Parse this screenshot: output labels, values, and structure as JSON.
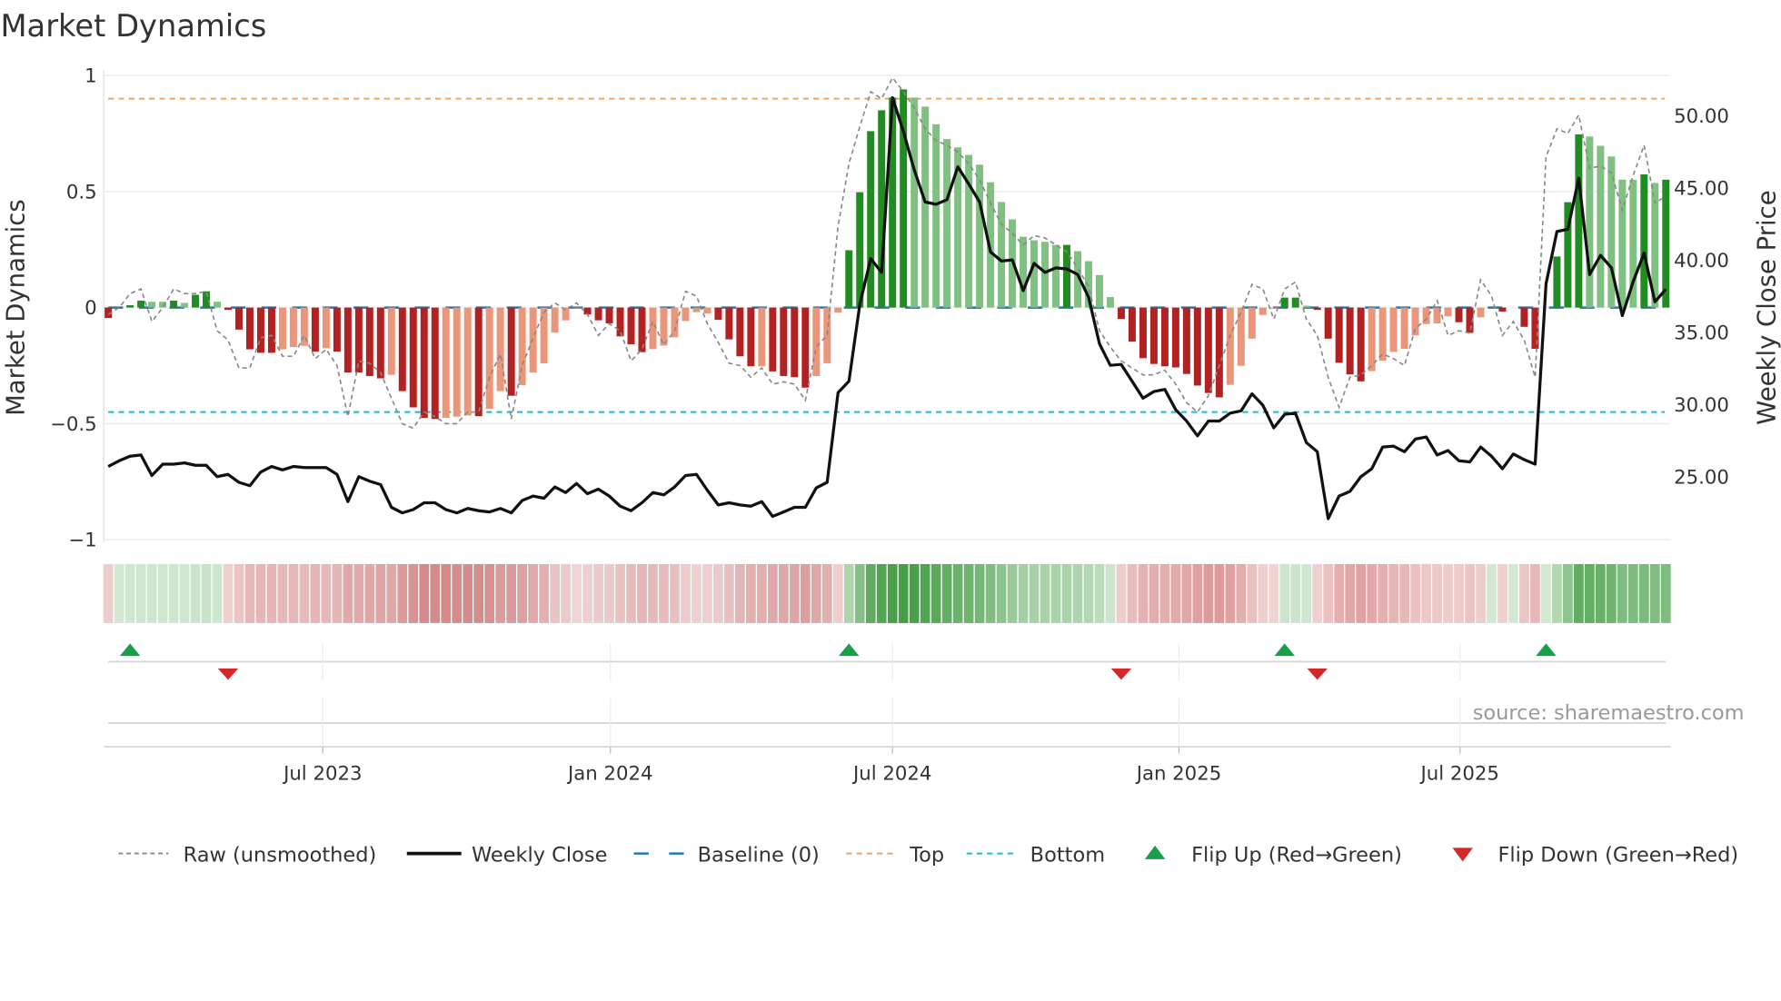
{
  "title": "Market Dynamics",
  "source": "source: sharemaestro.com",
  "chart_data": {
    "type": "bar",
    "title": "Market Dynamics",
    "ylabel": "Market Dynamics",
    "y2label": "Weekly Close Price",
    "ylim": [
      -1,
      1
    ],
    "y2lim": [
      20.44,
      52.67
    ],
    "grid": true,
    "legend_position": "bottom",
    "yticks": [
      {
        "value": 1,
        "label": "1"
      },
      {
        "value": 0.5,
        "label": "0.5"
      },
      {
        "value": 0,
        "label": "0"
      },
      {
        "value": -0.5,
        "label": "−0.5"
      },
      {
        "value": -1,
        "label": "−1"
      }
    ],
    "y2ticks": [
      {
        "value": 50,
        "label": "50.00"
      },
      {
        "value": 45,
        "label": "45.00"
      },
      {
        "value": 40,
        "label": "40.00"
      },
      {
        "value": 35,
        "label": "35.00"
      },
      {
        "value": 30,
        "label": "30.00"
      },
      {
        "value": 25,
        "label": "25.00"
      }
    ],
    "xticks": [
      {
        "week": 19.7,
        "label": "Jul 2023"
      },
      {
        "week": 46.1,
        "label": "Jan 2024"
      },
      {
        "week": 72.0,
        "label": "Jul 2024"
      },
      {
        "week": 98.3,
        "label": "Jan 2025"
      },
      {
        "week": 124.1,
        "label": "Jul 2025"
      }
    ],
    "reference_lines": {
      "baseline": 0,
      "top": 0.9,
      "bottom": -0.45
    },
    "series": [
      {
        "name": "Market Dynamics (smoothed)",
        "values": [
          -0.045,
          0,
          0.01,
          0.03,
          0.025,
          0.025,
          0.03,
          0.02,
          0.055,
          0.07,
          0.025,
          -0.01,
          -0.095,
          -0.18,
          -0.195,
          -0.195,
          -0.18,
          -0.17,
          -0.165,
          -0.19,
          -0.175,
          -0.19,
          -0.28,
          -0.28,
          -0.295,
          -0.305,
          -0.29,
          -0.36,
          -0.43,
          -0.476,
          -0.48,
          -0.475,
          -0.47,
          -0.465,
          -0.468,
          -0.437,
          -0.36,
          -0.38,
          -0.334,
          -0.28,
          -0.24,
          -0.108,
          -0.055,
          -0.003,
          -0.03,
          -0.055,
          -0.068,
          -0.124,
          -0.158,
          -0.192,
          -0.179,
          -0.164,
          -0.128,
          -0.058,
          -0.02,
          -0.025,
          -0.053,
          -0.137,
          -0.21,
          -0.253,
          -0.253,
          -0.275,
          -0.295,
          -0.3,
          -0.345,
          -0.295,
          -0.24,
          -0.022,
          0.247,
          0.497,
          0.76,
          0.85,
          0.905,
          0.94,
          0.905,
          0.866,
          0.79,
          0.726,
          0.69,
          0.658,
          0.616,
          0.54,
          0.455,
          0.38,
          0.305,
          0.29,
          0.283,
          0.27,
          0.27,
          0.243,
          0.2,
          0.14,
          0.045,
          -0.049,
          -0.147,
          -0.218,
          -0.243,
          -0.253,
          -0.258,
          -0.286,
          -0.336,
          -0.368,
          -0.387,
          -0.333,
          -0.251,
          -0.134,
          -0.032,
          -0.005,
          0.043,
          0.043,
          0.008,
          -0.01,
          -0.134,
          -0.238,
          -0.288,
          -0.318,
          -0.274,
          -0.229,
          -0.191,
          -0.178,
          -0.12,
          -0.071,
          -0.068,
          -0.038,
          -0.063,
          -0.109,
          -0.042,
          0,
          -0.017,
          0,
          -0.083,
          -0.178,
          0,
          0.22,
          0.454,
          0.746,
          0.737,
          0.697,
          0.651,
          0.551,
          0.551,
          0.574,
          0.537,
          0.551
        ],
        "strong": [
          1,
          0,
          1,
          1,
          0,
          0,
          1,
          0,
          1,
          1,
          0,
          1,
          1,
          1,
          1,
          1,
          0,
          0,
          0,
          1,
          0,
          1,
          1,
          1,
          1,
          1,
          0,
          1,
          1,
          1,
          1,
          0,
          0,
          0,
          1,
          0,
          0,
          1,
          0,
          0,
          0,
          0,
          0,
          0,
          1,
          1,
          1,
          1,
          1,
          1,
          0,
          0,
          0,
          0,
          0,
          0,
          1,
          1,
          1,
          1,
          0,
          1,
          1,
          1,
          1,
          0,
          0,
          0,
          1,
          1,
          1,
          1,
          1,
          1,
          0,
          0,
          0,
          0,
          0,
          0,
          0,
          0,
          0,
          0,
          0,
          0,
          0,
          0,
          1,
          0,
          0,
          0,
          0,
          1,
          1,
          1,
          1,
          1,
          1,
          1,
          1,
          1,
          1,
          0,
          0,
          0,
          0,
          0,
          1,
          1,
          0,
          1,
          1,
          1,
          1,
          1,
          0,
          0,
          0,
          0,
          0,
          0,
          0,
          0,
          1,
          1,
          0,
          0,
          1,
          0,
          1,
          1,
          0,
          1,
          1,
          1,
          0,
          0,
          0,
          0,
          0,
          1,
          0,
          1
        ]
      },
      {
        "name": "Raw (unsmoothed)",
        "values": [
          -0.03,
          0,
          0.06,
          0.08,
          -0.06,
          0,
          0.08,
          0.06,
          0.06,
          0.07,
          -0.1,
          -0.14,
          -0.26,
          -0.26,
          -0.13,
          -0.12,
          -0.21,
          -0.21,
          -0.12,
          -0.22,
          -0.18,
          -0.25,
          -0.47,
          -0.23,
          -0.24,
          -0.28,
          -0.39,
          -0.5,
          -0.52,
          -0.45,
          -0.47,
          -0.5,
          -0.5,
          -0.45,
          -0.45,
          -0.3,
          -0.2,
          -0.48,
          -0.25,
          -0.13,
          -0.02,
          0.02,
          -0.01,
          0.02,
          -0.03,
          -0.12,
          -0.07,
          -0.1,
          -0.23,
          -0.18,
          -0.06,
          -0.16,
          -0.1,
          0.07,
          0.05,
          -0.07,
          -0.15,
          -0.24,
          -0.25,
          -0.3,
          -0.26,
          -0.33,
          -0.32,
          -0.33,
          -0.4,
          -0.17,
          -0.12,
          0.35,
          0.62,
          0.78,
          0.93,
          0.9,
          0.99,
          0.93,
          0.86,
          0.77,
          0.72,
          0.7,
          0.67,
          0.62,
          0.55,
          0.45,
          0.36,
          0.32,
          0.27,
          0.31,
          0.3,
          0.27,
          0.24,
          0.17,
          0.09,
          -0.1,
          -0.17,
          -0.23,
          -0.26,
          -0.29,
          -0.29,
          -0.27,
          -0.33,
          -0.41,
          -0.45,
          -0.38,
          -0.25,
          -0.12,
          -0.02,
          0.1,
          0.08,
          -0.05,
          0.08,
          0.11,
          -0.05,
          -0.12,
          -0.3,
          -0.43,
          -0.3,
          -0.29,
          -0.25,
          -0.2,
          -0.22,
          -0.25,
          -0.09,
          -0.05,
          0.03,
          -0.12,
          -0.1,
          -0.11,
          0.12,
          0.05,
          -0.12,
          -0.06,
          -0.14,
          -0.3,
          0.65,
          0.77,
          0.75,
          0.83,
          0.6,
          0.61,
          0.58,
          0.42,
          0.57,
          0.7,
          0.45,
          0.48
        ]
      },
      {
        "name": "Weekly Close",
        "axis": "right",
        "values": [
          25.63,
          26.02,
          26.34,
          26.42,
          25.0,
          25.79,
          25.79,
          25.87,
          25.71,
          25.71,
          24.92,
          25.08,
          24.53,
          24.29,
          25.24,
          25.63,
          25.39,
          25.63,
          25.55,
          25.55,
          25.55,
          25.08,
          23.19,
          24.92,
          24.61,
          24.37,
          22.8,
          22.41,
          22.64,
          23.11,
          23.11,
          22.64,
          22.41,
          22.72,
          22.56,
          22.48,
          22.72,
          22.41,
          23.27,
          23.58,
          23.43,
          24.21,
          23.82,
          24.45,
          23.74,
          24.06,
          23.58,
          22.88,
          22.56,
          23.11,
          23.82,
          23.66,
          24.21,
          25.0,
          25.08,
          23.98,
          22.96,
          23.11,
          22.96,
          22.88,
          23.19,
          22.17,
          22.48,
          22.8,
          22.8,
          24.14,
          24.53,
          30.74,
          31.53,
          36.87,
          40.02,
          39.07,
          51.18,
          48.82,
          46.15,
          43.95,
          43.79,
          44.1,
          46.38,
          45.2,
          43.95,
          40.49,
          39.86,
          39.94,
          37.81,
          39.7,
          39.07,
          39.39,
          39.31,
          38.92,
          37.34,
          34.12,
          32.63,
          32.7,
          31.53,
          30.35,
          30.82,
          30.97,
          29.56,
          28.77,
          27.75,
          28.77,
          28.77,
          29.32,
          29.48,
          30.66,
          29.87,
          28.3,
          29.24,
          29.32,
          27.28,
          26.65,
          22.01,
          23.58,
          23.9,
          24.92,
          25.47,
          26.97,
          27.04,
          26.65,
          27.52,
          27.67,
          26.42,
          26.73,
          26.02,
          25.94,
          26.97,
          26.34,
          25.47,
          26.49,
          26.1,
          25.79,
          38.29,
          41.9,
          42.06,
          45.6,
          38.92,
          40.25,
          39.39,
          36.08,
          38.44,
          40.41,
          37.03,
          37.9
        ]
      }
    ],
    "flip_up": [
      2,
      68,
      108,
      132
    ],
    "flip_down": [
      11,
      93,
      111
    ],
    "legend": [
      {
        "label": "Raw (unsmoothed)",
        "kind": "raw"
      },
      {
        "label": "Weekly Close",
        "kind": "close"
      },
      {
        "label": "Baseline (0)",
        "kind": "baseline"
      },
      {
        "label": "Top",
        "kind": "top"
      },
      {
        "label": "Bottom",
        "kind": "bottom"
      },
      {
        "label": "Flip Up (Red→Green)",
        "kind": "up"
      },
      {
        "label": "Flip Down (Green→Red)",
        "kind": "down"
      }
    ],
    "colors": {
      "pos_strong": "#228b22",
      "pos_weak": "#80c080",
      "neg_strong": "#b22222",
      "neg_weak": "#e9967a",
      "raw": "#888888",
      "close": "#111111",
      "baseline": "#1f77b4",
      "top": "#f4a460",
      "bottom": "#17becf",
      "flip_up": "#1a9e4a",
      "flip_down": "#d62728"
    }
  }
}
